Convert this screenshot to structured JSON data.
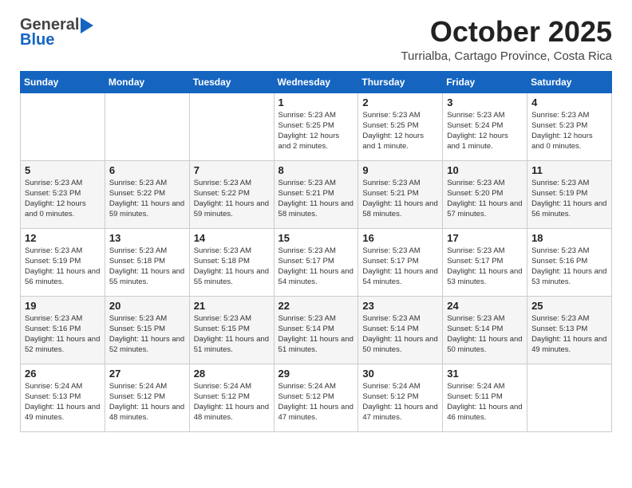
{
  "header": {
    "logo_general": "General",
    "logo_blue": "Blue",
    "month": "October 2025",
    "location": "Turrialba, Cartago Province, Costa Rica"
  },
  "days_of_week": [
    "Sunday",
    "Monday",
    "Tuesday",
    "Wednesday",
    "Thursday",
    "Friday",
    "Saturday"
  ],
  "weeks": [
    [
      {
        "day": "",
        "info": ""
      },
      {
        "day": "",
        "info": ""
      },
      {
        "day": "",
        "info": ""
      },
      {
        "day": "1",
        "info": "Sunrise: 5:23 AM\nSunset: 5:25 PM\nDaylight: 12 hours\nand 2 minutes."
      },
      {
        "day": "2",
        "info": "Sunrise: 5:23 AM\nSunset: 5:25 PM\nDaylight: 12 hours\nand 1 minute."
      },
      {
        "day": "3",
        "info": "Sunrise: 5:23 AM\nSunset: 5:24 PM\nDaylight: 12 hours\nand 1 minute."
      },
      {
        "day": "4",
        "info": "Sunrise: 5:23 AM\nSunset: 5:23 PM\nDaylight: 12 hours\nand 0 minutes."
      }
    ],
    [
      {
        "day": "5",
        "info": "Sunrise: 5:23 AM\nSunset: 5:23 PM\nDaylight: 12 hours\nand 0 minutes."
      },
      {
        "day": "6",
        "info": "Sunrise: 5:23 AM\nSunset: 5:22 PM\nDaylight: 11 hours\nand 59 minutes."
      },
      {
        "day": "7",
        "info": "Sunrise: 5:23 AM\nSunset: 5:22 PM\nDaylight: 11 hours\nand 59 minutes."
      },
      {
        "day": "8",
        "info": "Sunrise: 5:23 AM\nSunset: 5:21 PM\nDaylight: 11 hours\nand 58 minutes."
      },
      {
        "day": "9",
        "info": "Sunrise: 5:23 AM\nSunset: 5:21 PM\nDaylight: 11 hours\nand 58 minutes."
      },
      {
        "day": "10",
        "info": "Sunrise: 5:23 AM\nSunset: 5:20 PM\nDaylight: 11 hours\nand 57 minutes."
      },
      {
        "day": "11",
        "info": "Sunrise: 5:23 AM\nSunset: 5:19 PM\nDaylight: 11 hours\nand 56 minutes."
      }
    ],
    [
      {
        "day": "12",
        "info": "Sunrise: 5:23 AM\nSunset: 5:19 PM\nDaylight: 11 hours\nand 56 minutes."
      },
      {
        "day": "13",
        "info": "Sunrise: 5:23 AM\nSunset: 5:18 PM\nDaylight: 11 hours\nand 55 minutes."
      },
      {
        "day": "14",
        "info": "Sunrise: 5:23 AM\nSunset: 5:18 PM\nDaylight: 11 hours\nand 55 minutes."
      },
      {
        "day": "15",
        "info": "Sunrise: 5:23 AM\nSunset: 5:17 PM\nDaylight: 11 hours\nand 54 minutes."
      },
      {
        "day": "16",
        "info": "Sunrise: 5:23 AM\nSunset: 5:17 PM\nDaylight: 11 hours\nand 54 minutes."
      },
      {
        "day": "17",
        "info": "Sunrise: 5:23 AM\nSunset: 5:17 PM\nDaylight: 11 hours\nand 53 minutes."
      },
      {
        "day": "18",
        "info": "Sunrise: 5:23 AM\nSunset: 5:16 PM\nDaylight: 11 hours\nand 53 minutes."
      }
    ],
    [
      {
        "day": "19",
        "info": "Sunrise: 5:23 AM\nSunset: 5:16 PM\nDaylight: 11 hours\nand 52 minutes."
      },
      {
        "day": "20",
        "info": "Sunrise: 5:23 AM\nSunset: 5:15 PM\nDaylight: 11 hours\nand 52 minutes."
      },
      {
        "day": "21",
        "info": "Sunrise: 5:23 AM\nSunset: 5:15 PM\nDaylight: 11 hours\nand 51 minutes."
      },
      {
        "day": "22",
        "info": "Sunrise: 5:23 AM\nSunset: 5:14 PM\nDaylight: 11 hours\nand 51 minutes."
      },
      {
        "day": "23",
        "info": "Sunrise: 5:23 AM\nSunset: 5:14 PM\nDaylight: 11 hours\nand 50 minutes."
      },
      {
        "day": "24",
        "info": "Sunrise: 5:23 AM\nSunset: 5:14 PM\nDaylight: 11 hours\nand 50 minutes."
      },
      {
        "day": "25",
        "info": "Sunrise: 5:23 AM\nSunset: 5:13 PM\nDaylight: 11 hours\nand 49 minutes."
      }
    ],
    [
      {
        "day": "26",
        "info": "Sunrise: 5:24 AM\nSunset: 5:13 PM\nDaylight: 11 hours\nand 49 minutes."
      },
      {
        "day": "27",
        "info": "Sunrise: 5:24 AM\nSunset: 5:12 PM\nDaylight: 11 hours\nand 48 minutes."
      },
      {
        "day": "28",
        "info": "Sunrise: 5:24 AM\nSunset: 5:12 PM\nDaylight: 11 hours\nand 48 minutes."
      },
      {
        "day": "29",
        "info": "Sunrise: 5:24 AM\nSunset: 5:12 PM\nDaylight: 11 hours\nand 47 minutes."
      },
      {
        "day": "30",
        "info": "Sunrise: 5:24 AM\nSunset: 5:12 PM\nDaylight: 11 hours\nand 47 minutes."
      },
      {
        "day": "31",
        "info": "Sunrise: 5:24 AM\nSunset: 5:11 PM\nDaylight: 11 hours\nand 46 minutes."
      },
      {
        "day": "",
        "info": ""
      }
    ]
  ]
}
